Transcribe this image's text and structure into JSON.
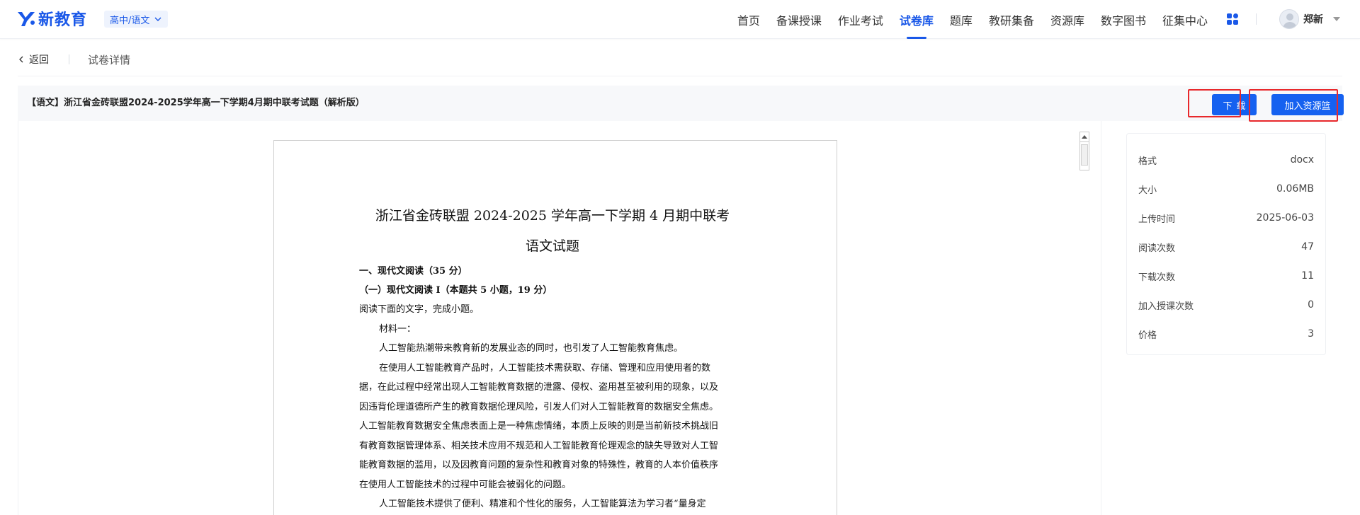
{
  "brand": {
    "name": "新教育",
    "color": "#1a58e8"
  },
  "grade_select": {
    "value": "高中/语文"
  },
  "nav": {
    "items": [
      {
        "label": "首页",
        "active": false
      },
      {
        "label": "备课授课",
        "active": false
      },
      {
        "label": "作业考试",
        "active": false
      },
      {
        "label": "试卷库",
        "active": true
      },
      {
        "label": "题库",
        "active": false
      },
      {
        "label": "教研集备",
        "active": false
      },
      {
        "label": "资源库",
        "active": false
      },
      {
        "label": "数字图书",
        "active": false
      },
      {
        "label": "征集中心",
        "active": false
      }
    ]
  },
  "user": {
    "name": "郑新"
  },
  "breadcrumb": {
    "back_label": "返回",
    "current": "试卷详情"
  },
  "document": {
    "title": "【语文】浙江省金砖联盟2024-2025学年高一下学期4月期中联考试题（解析版）",
    "download_label": "下载",
    "add_basket_label": "加入资源篮"
  },
  "preview": {
    "heading1": "浙江省金砖联盟 2024-2025 学年高一下学期 4 月期中联考",
    "heading2": "语文试题",
    "section1": "一、现代文阅读（35 分）",
    "section2": "（一）现代文阅读 I（本题共 5 小题，19 分）",
    "instruction": "阅读下面的文字，完成小题。",
    "material_label": "材料一：",
    "para1": "人工智能热潮带来教育新的发展业态的同时，也引发了人工智能教育焦虑。",
    "para2_lines": [
      "在使用人工智能教育产品时，人工智能技术需获取、存储、管理和应用使用者的数",
      "据，在此过程中经常出现人工智能教育数据的泄露、侵权、盗用甚至被利用的现象，以及",
      "因违背伦理道德所产生的教育数据伦理风险，引发人们对人工智能教育的数据安全焦虑。",
      "人工智能教育数据安全焦虑表面上是一种焦虑情绪，本质上反映的则是当前新技术挑战旧",
      "有教育数据管理体系、相关技术应用不规范和人工智能教育伦理观念的缺失导致对人工智",
      "能教育数据的滥用，以及因教育问题的复杂性和教育对象的特殊性，教育的人本价值秩序",
      "在使用人工智能技术的过程中可能会被弱化的问题。"
    ],
    "para3": "人工智能技术提供了便利、精准和个性化的服务，人工智能算法为学习者“量身定"
  },
  "info": [
    {
      "key": "格式",
      "value": "docx"
    },
    {
      "key": "大小",
      "value": "0.06MB"
    },
    {
      "key": "上传时间",
      "value": "2025-06-03"
    },
    {
      "key": "阅读次数",
      "value": "47"
    },
    {
      "key": "下载次数",
      "value": "11"
    },
    {
      "key": "加入授课次数",
      "value": "0"
    },
    {
      "key": "价格",
      "value": "3"
    }
  ],
  "colors": {
    "primary": "#1561f0",
    "highlight": "#e8282b"
  },
  "icons": [
    "logo-icon",
    "chevron-down-icon",
    "apps-icon",
    "avatar-icon",
    "caret-down-icon",
    "chevron-left-icon",
    "scroll-up-icon"
  ]
}
